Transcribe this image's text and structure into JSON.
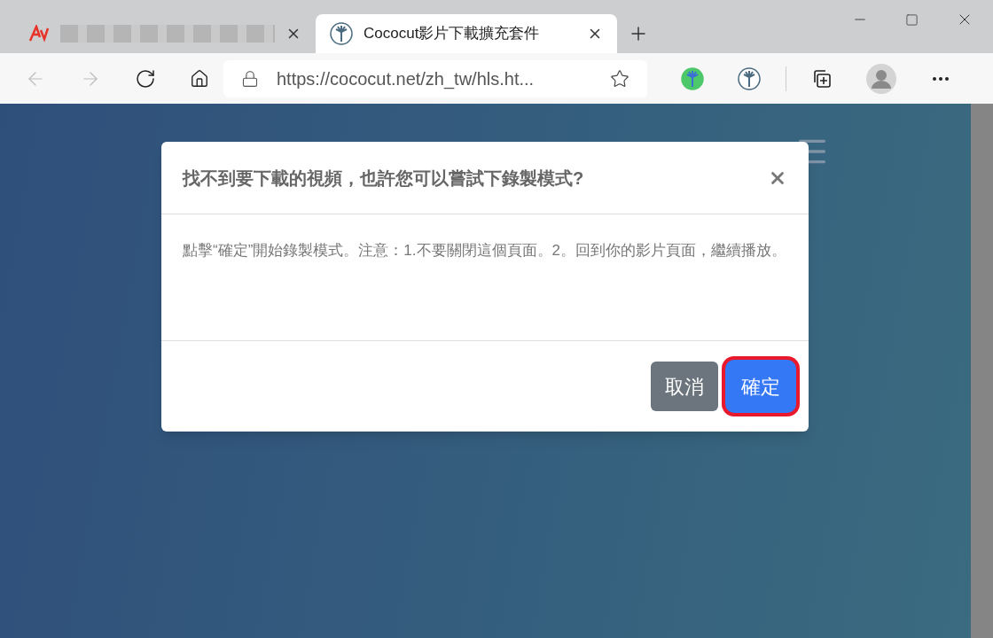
{
  "tabs": [
    {
      "kind": "redacted",
      "selected": false
    },
    {
      "kind": "page",
      "title": "Cococut影片下載擴充套件",
      "selected": true
    }
  ],
  "address_bar": {
    "url": "https://cococut.net/zh_tw/hls.ht..."
  },
  "dialog": {
    "title": "找不到要下載的視頻，也許您可以嘗試下錄製模式?",
    "message": "點擊“確定”開始錄製模式。注意：1.不要關閉這個頁面。2。回到你的影片頁面，繼續播放。",
    "buttons": [
      {
        "label": "取消",
        "kind": "secondary",
        "highlighted": false
      },
      {
        "label": "確定",
        "kind": "primary",
        "highlighted": true
      }
    ]
  }
}
